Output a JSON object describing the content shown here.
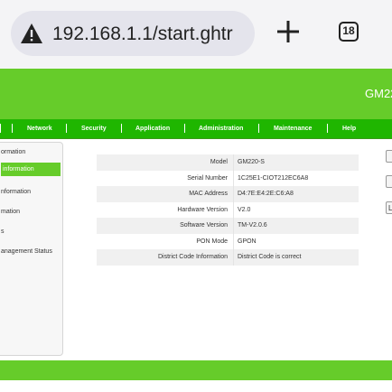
{
  "browser": {
    "url": "192.168.1.1/start.ghtr",
    "tab_count": "18",
    "icons": {
      "security": "warning-triangle-icon",
      "new_tab": "plus-icon",
      "tabs": "tab-switcher-icon"
    }
  },
  "router": {
    "brand": "GM22",
    "nav": [
      {
        "label": "Network"
      },
      {
        "label": "Security"
      },
      {
        "label": "Application"
      },
      {
        "label": "Administration"
      },
      {
        "label": "Maintenance"
      },
      {
        "label": "Help"
      }
    ],
    "sidebar": [
      {
        "label": "ormation"
      },
      {
        "label": "information",
        "active": true
      },
      {
        "label": "nformation"
      },
      {
        "label": "mation"
      },
      {
        "label": "s"
      },
      {
        "label": "anagement Status"
      }
    ],
    "device_info": [
      {
        "label": "Model",
        "value": "GM220-S"
      },
      {
        "label": "Serial Number",
        "value": "1C25E1-CIOT212EC6A8"
      },
      {
        "label": "MAC Address",
        "value": "D4:7E:E4:2E:C6:A8"
      },
      {
        "label": "Hardware Version",
        "value": "V2.0"
      },
      {
        "label": "Software Version",
        "value": "TM-V2.0.6"
      },
      {
        "label": "PON Mode",
        "value": "GPON"
      },
      {
        "label": "District Code Information",
        "value": "District Code is correct"
      }
    ],
    "edge_buttons": [
      "",
      "",
      "L"
    ]
  },
  "colors": {
    "header_green": "#66cc2a",
    "nav_green": "#1fb600",
    "active_item": "#66cc2a"
  }
}
